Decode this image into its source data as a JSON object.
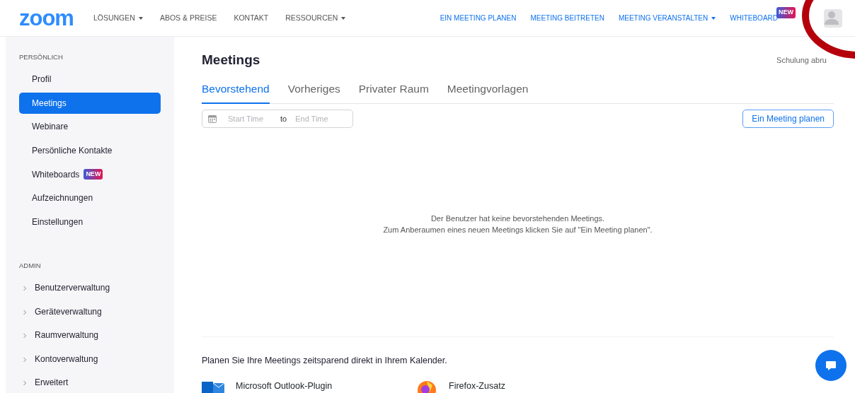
{
  "header": {
    "logo": "zoom",
    "nav_left": [
      {
        "label": "LÖSUNGEN",
        "dropdown": true
      },
      {
        "label": "ABOS & PREISE",
        "dropdown": false
      },
      {
        "label": "KONTAKT",
        "dropdown": false
      },
      {
        "label": "RESSOURCEN",
        "dropdown": true
      }
    ],
    "nav_right": [
      {
        "label": "EIN MEETING PLANEN",
        "dropdown": false
      },
      {
        "label": "MEETING BEITRETEN",
        "dropdown": false
      },
      {
        "label": "MEETING VERANSTALTEN",
        "dropdown": true
      },
      {
        "label": "WHITEBOARD",
        "dropdown": false,
        "badge": "NEW"
      }
    ]
  },
  "sidebar": {
    "sections": [
      {
        "title": "PERSÖNLICH",
        "items": [
          {
            "label": "Profil",
            "selected": false
          },
          {
            "label": "Meetings",
            "selected": true
          },
          {
            "label": "Webinare",
            "selected": false
          },
          {
            "label": "Persönliche Kontakte",
            "selected": false
          },
          {
            "label": "Whiteboards",
            "selected": false,
            "badge": "NEW"
          },
          {
            "label": "Aufzeichnungen",
            "selected": false
          },
          {
            "label": "Einstellungen",
            "selected": false
          }
        ]
      },
      {
        "title": "ADMIN",
        "items": [
          {
            "label": "Benutzerverwaltung",
            "selected": false,
            "expanded": false
          },
          {
            "label": "Geräteverwaltung",
            "selected": false,
            "expanded": false
          },
          {
            "label": "Raumverwaltung",
            "selected": false,
            "expanded": false
          },
          {
            "label": "Kontoverwaltung",
            "selected": false,
            "expanded": false
          },
          {
            "label": "Erweitert",
            "selected": false,
            "expanded": false
          }
        ]
      }
    ]
  },
  "main": {
    "title": "Meetings",
    "training_link": "Schulung abru",
    "tabs": [
      {
        "label": "Bevorstehend",
        "selected": true
      },
      {
        "label": "Vorheriges",
        "selected": false
      },
      {
        "label": "Privater Raum",
        "selected": false
      },
      {
        "label": "Meetingvorlagen",
        "selected": false
      }
    ],
    "date_range": {
      "start_placeholder": "Start Time",
      "separator": "to",
      "end_placeholder": "End Time"
    },
    "schedule_button": "Ein Meeting planen",
    "empty_message": [
      "Der Benutzer hat keine bevorstehenden Meetings.",
      "Zum Anberaumen eines neuen Meetings klicken Sie auf \"Ein Meeting planen\"."
    ],
    "calendar_hint": "Planen Sie Ihre Meetings zeitsparend direkt in Ihrem Kalender.",
    "plugins": [
      {
        "kind": "outlook",
        "label": "Microsoft Outlook-Plugin"
      },
      {
        "kind": "firefox",
        "label": "Firefox-Zusatz"
      }
    ]
  }
}
